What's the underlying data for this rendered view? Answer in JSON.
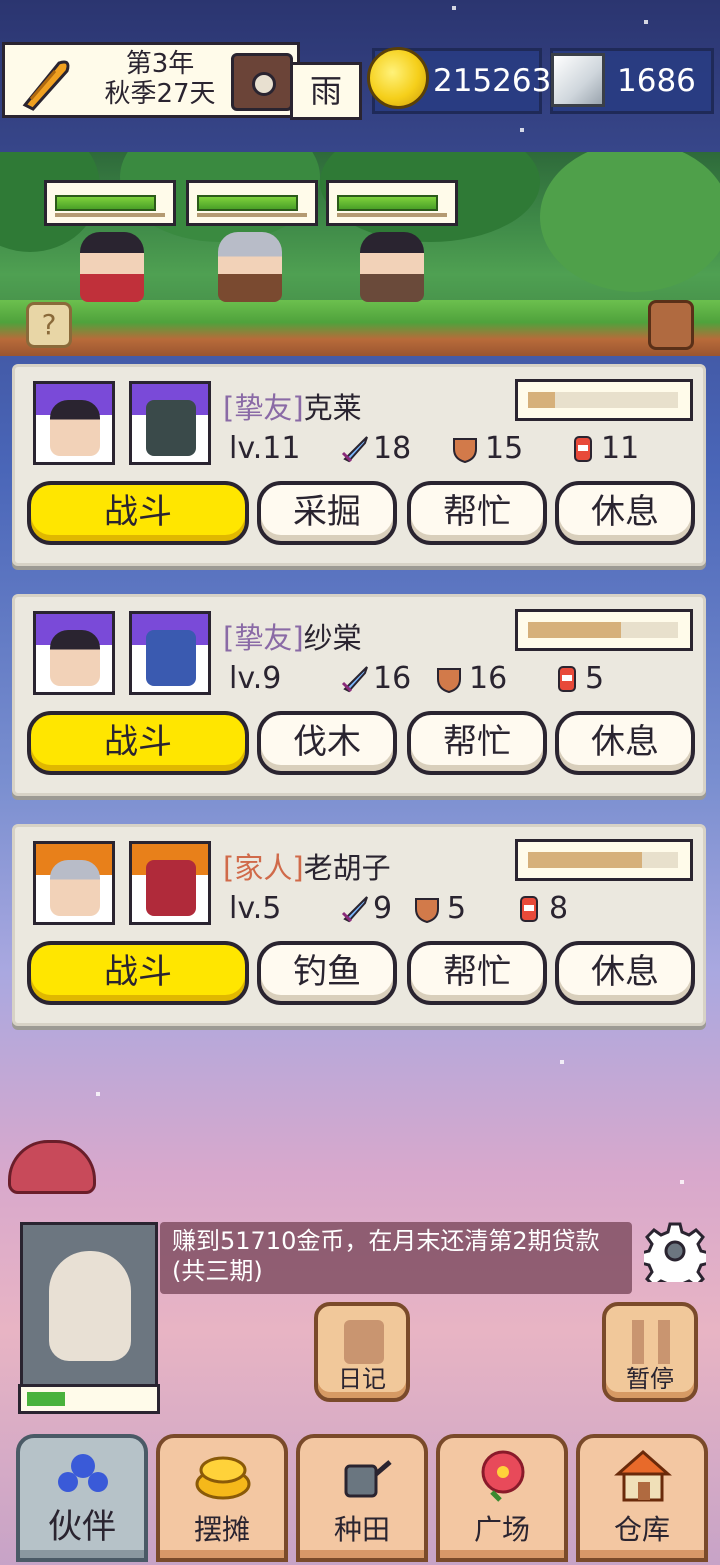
{
  "header": {
    "date_line1": "第3年",
    "date_line2": "秋季27天",
    "weather": "雨",
    "gold": "215263",
    "gems": "1686"
  },
  "scene": {
    "help_label": "?",
    "hp_fractions": [
      0.92,
      0.92,
      0.92
    ]
  },
  "partners": [
    {
      "relation": "[挚友]",
      "name": "克莱",
      "relation_color": "#8a6aa6",
      "level": "lv.11",
      "attack": "18",
      "defense": "15",
      "stamina": "11",
      "progress": 0.18,
      "buttons": [
        "战斗",
        "采掘",
        "帮忙",
        "休息"
      ]
    },
    {
      "relation": "[挚友]",
      "name": "纱棠",
      "relation_color": "#8a6aa6",
      "level": "lv.9",
      "attack": "16",
      "defense": "16",
      "stamina": "5",
      "progress": 0.62,
      "buttons": [
        "战斗",
        "伐木",
        "帮忙",
        "休息"
      ]
    },
    {
      "relation": "[家人]",
      "name": "老胡子",
      "relation_color": "#d06a4a",
      "level": "lv.5",
      "attack": "9",
      "defense": "5",
      "stamina": "8",
      "progress": 0.76,
      "buttons": [
        "战斗",
        "钓鱼",
        "帮忙",
        "休息"
      ]
    }
  ],
  "message": "赚到51710金币，在月末还清第2期贷款(共三期)",
  "npc_energy": 0.3,
  "actions": {
    "diary": "日记",
    "pause": "暂停"
  },
  "nav": [
    "伙伴",
    "摆摊",
    "种田",
    "广场",
    "仓库"
  ],
  "colors": {
    "fight_button": "#ffe600",
    "hp_green": "#4aa028",
    "gold_coin": "#f5cf1a"
  }
}
